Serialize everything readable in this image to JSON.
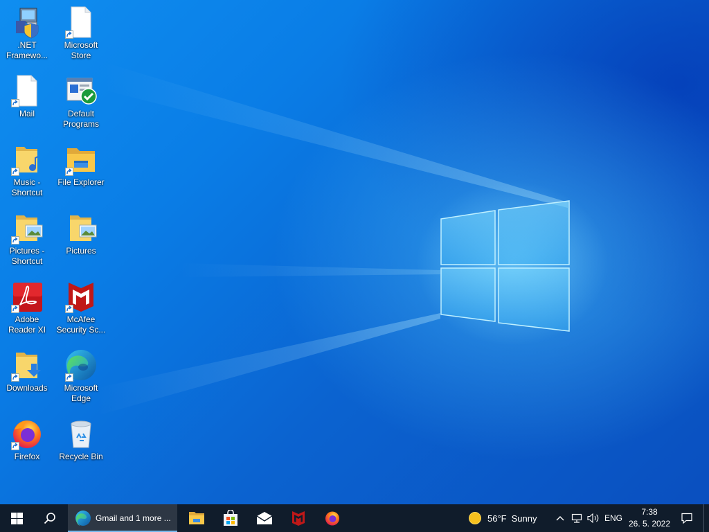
{
  "desktop": {
    "icons": [
      {
        "label": ".NET Framewo..."
      },
      {
        "label": "Microsoft Store"
      },
      {
        "label": "Mail"
      },
      {
        "label": "Default Programs"
      },
      {
        "label": "Music - Shortcut"
      },
      {
        "label": "File Explorer"
      },
      {
        "label": "Pictures - Shortcut"
      },
      {
        "label": "Pictures"
      },
      {
        "label": "Adobe Reader XI"
      },
      {
        "label": "McAfee Security Sc..."
      },
      {
        "label": "Downloads"
      },
      {
        "label": "Microsoft Edge"
      },
      {
        "label": "Firefox"
      },
      {
        "label": "Recycle Bin"
      }
    ]
  },
  "taskbar": {
    "edge_window_title": "Gmail and 1 more ...",
    "weather": {
      "temperature": "56°F",
      "condition": "Sunny"
    },
    "language": "ENG",
    "time": "7:38",
    "date": "26. 5. 2022"
  },
  "colors": {
    "taskbar_bg": "#101c2b",
    "accent": "#76b9ed",
    "wallpaper": "#0a6fd6"
  }
}
